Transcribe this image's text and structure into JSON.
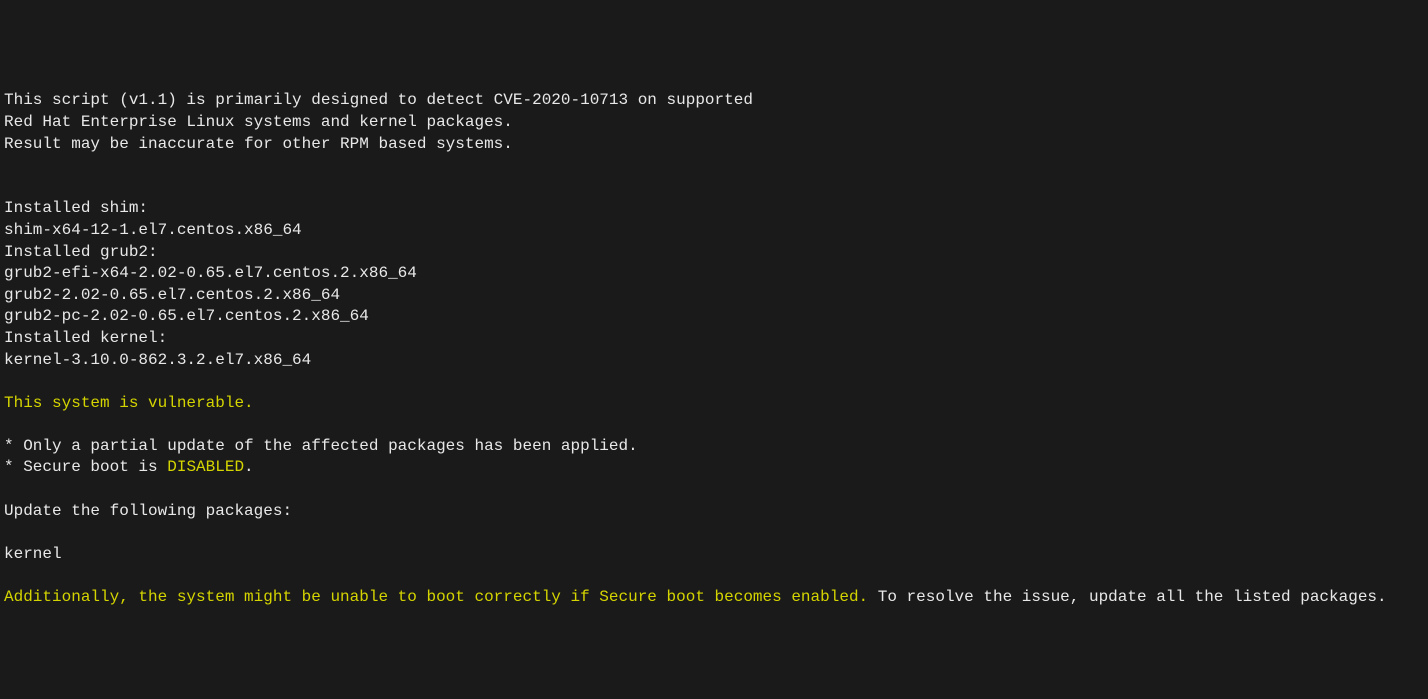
{
  "header": {
    "line1": "This script (v1.1) is primarily designed to detect CVE-2020-10713 on supported",
    "line2": "Red Hat Enterprise Linux systems and kernel packages.",
    "line3": "Result may be inaccurate for other RPM based systems."
  },
  "installed": {
    "shim_label": "Installed shim:",
    "shim_pkg": "shim-x64-12-1.el7.centos.x86_64",
    "grub2_label": "Installed grub2:",
    "grub2_pkg1": "grub2-efi-x64-2.02-0.65.el7.centos.2.x86_64",
    "grub2_pkg2": "grub2-2.02-0.65.el7.centos.2.x86_64",
    "grub2_pkg3": "grub2-pc-2.02-0.65.el7.centos.2.x86_64",
    "kernel_label": "Installed kernel:",
    "kernel_pkg": "kernel-3.10.0-862.3.2.el7.x86_64"
  },
  "vulnerable": "This system is vulnerable.",
  "details": {
    "bullet1": "* Only a partial update of the affected packages has been applied.",
    "bullet2_prefix": "* Secure boot is ",
    "bullet2_status": "DISABLED",
    "bullet2_suffix": "."
  },
  "update": {
    "heading": "Update the following packages:",
    "pkg": "kernel"
  },
  "footer": {
    "warn": "Additionally, the system might be unable to boot correctly if Secure boot becomes enabled.",
    "rest": " To resolve the issue, update all the listed packages."
  }
}
